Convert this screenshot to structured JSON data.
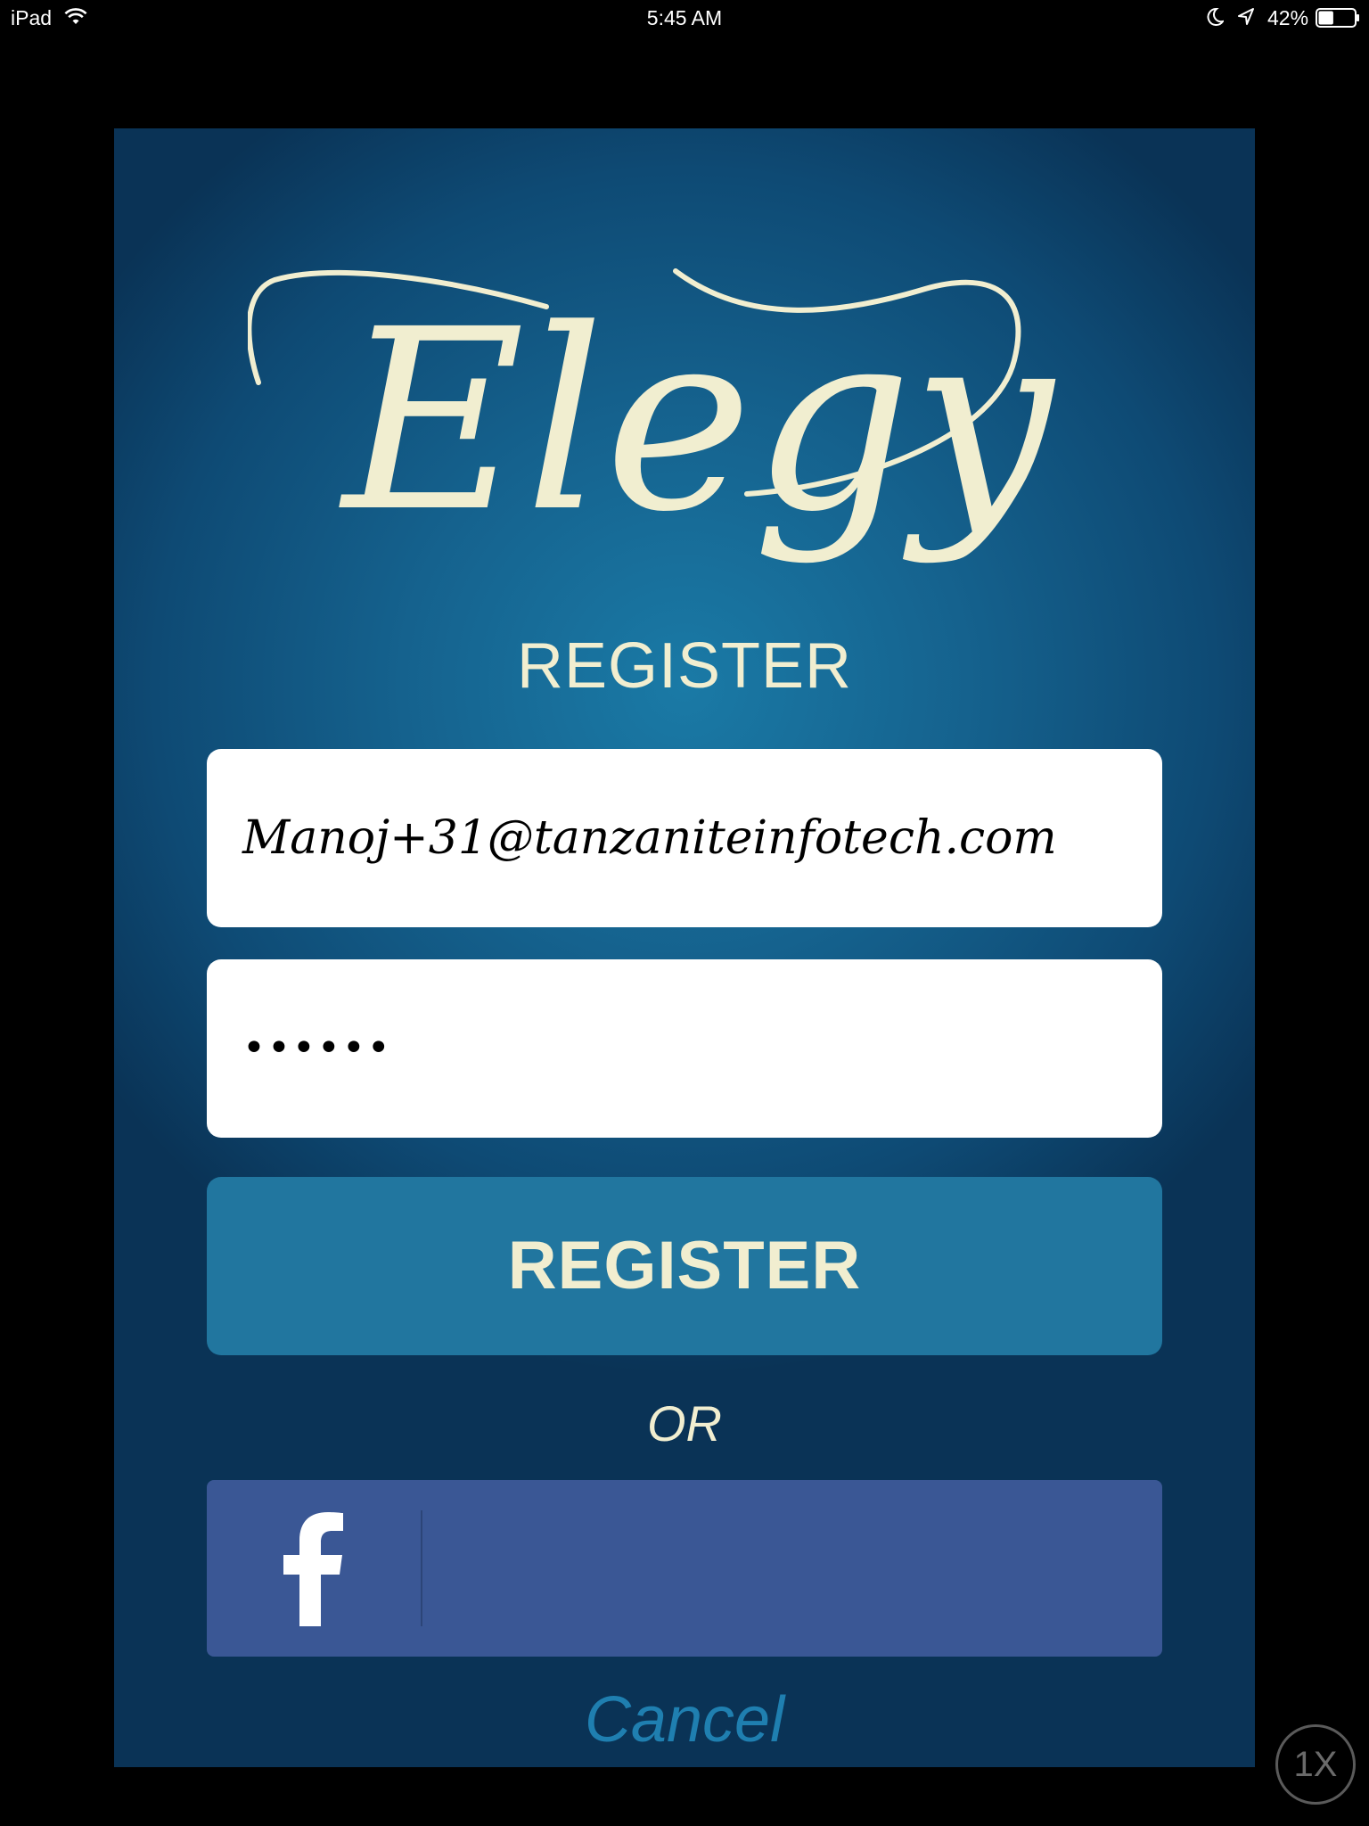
{
  "status_bar": {
    "device": "iPad",
    "time": "5:45 AM",
    "battery_percent": "42%",
    "battery_level": 0.42,
    "icons": [
      "wifi-icon",
      "moon-icon",
      "location-arrow-icon",
      "battery-icon"
    ]
  },
  "logo": {
    "text": "Elegy"
  },
  "register_form": {
    "heading": "REGISTER",
    "email_value": "Manoj+31@tanzaniteinfotech.com",
    "password_value": "••••••",
    "register_button_label": "REGISTER",
    "or_text": "OR",
    "facebook_button": {
      "icon": "facebook-icon",
      "label": ""
    },
    "cancel_label": "Cancel"
  },
  "zoom_indicator": "1X",
  "colors": {
    "panel_top": "#0e4a74",
    "panel_center": "#1a7aa6",
    "cream_text": "#f1eed0",
    "register_button": "#21769f",
    "facebook_blue": "#3a5795",
    "cancel_link": "#1f7fb0"
  }
}
